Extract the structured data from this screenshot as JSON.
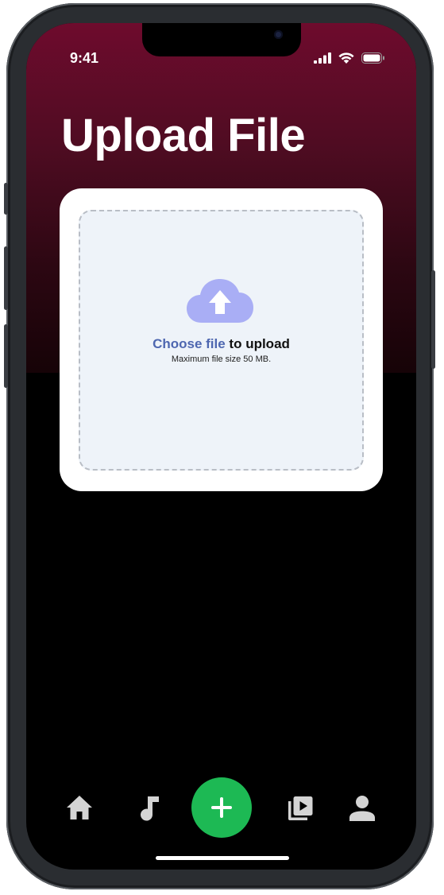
{
  "status_bar": {
    "time": "9:41",
    "icons": [
      "cellular-signal-icon",
      "wifi-icon",
      "battery-icon"
    ]
  },
  "header": {
    "title": "Upload File"
  },
  "upload": {
    "icon": "cloud-upload-icon",
    "choose_link": "Choose file",
    "suffix": " to upload",
    "max_size": "Maximum file size 50 MB."
  },
  "tab_bar": {
    "items": [
      {
        "icon": "home-icon"
      },
      {
        "icon": "music-note-icon"
      },
      {
        "icon": "plus-icon",
        "primary": true
      },
      {
        "icon": "video-library-icon"
      },
      {
        "icon": "profile-icon"
      }
    ]
  },
  "colors": {
    "accent_green": "#1db954",
    "link_blue": "#4e67b0",
    "cloud_purple": "#a9aef5",
    "header_gradient_top": "#6e0b2d"
  }
}
